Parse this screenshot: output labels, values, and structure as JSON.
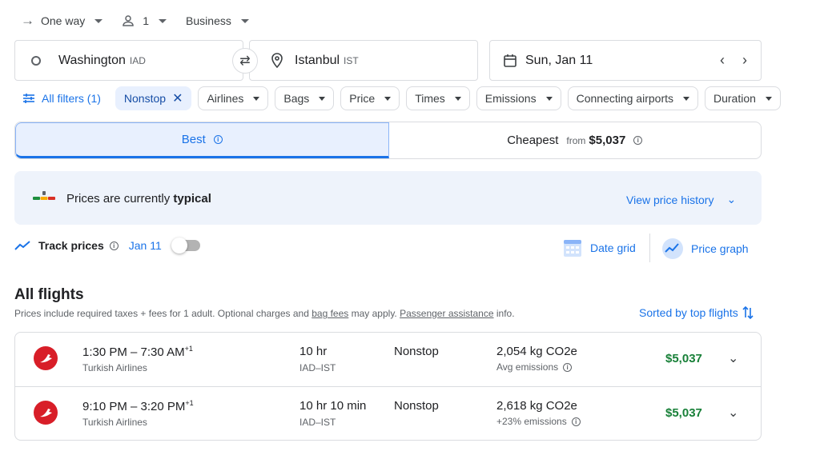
{
  "trip": {
    "type": "One way",
    "passengers": "1",
    "cabin": "Business"
  },
  "search": {
    "from_city": "Washington",
    "from_code": "IAD",
    "to_city": "Istanbul",
    "to_code": "IST",
    "date": "Sun, Jan 11"
  },
  "filters": {
    "all_filters": "All filters (1)",
    "nonstop": "Nonstop",
    "chips": [
      "Airlines",
      "Bags",
      "Price",
      "Times",
      "Emissions",
      "Connecting airports",
      "Duration"
    ]
  },
  "sort_tabs": {
    "best": "Best",
    "cheapest": "Cheapest",
    "from_label": "from",
    "cheapest_price": "$5,037"
  },
  "insight": {
    "prefix": "Prices are currently",
    "level": "typical",
    "view_history": "View price history"
  },
  "track": {
    "label": "Track prices",
    "date": "Jan 11",
    "date_grid": "Date grid",
    "price_graph": "Price graph"
  },
  "results": {
    "heading": "All flights",
    "disclaimer_1": "Prices include required taxes + fees for 1 adult. Optional charges and",
    "bag_fees": "bag fees",
    "disclaimer_2": "may apply.",
    "passenger_assistance": "Passenger assistance",
    "disclaimer_3": "info.",
    "sorted_by": "Sorted by top flights",
    "flights": [
      {
        "times": "1:30 PM – 7:30 AM",
        "day_offset": "+1",
        "airline": "Turkish Airlines",
        "duration": "10 hr",
        "route": "IAD–IST",
        "stops": "Nonstop",
        "emissions": "2,054 kg CO2e",
        "emissions_note": "Avg emissions",
        "price": "$5,037"
      },
      {
        "times": "9:10 PM – 3:20 PM",
        "day_offset": "+1",
        "airline": "Turkish Airlines",
        "duration": "10 hr 10 min",
        "route": "IAD–IST",
        "stops": "Nonstop",
        "emissions": "2,618 kg CO2e",
        "emissions_note": "+23% emissions",
        "price": "$5,037"
      }
    ]
  },
  "colors": {
    "accent": "#1a73e8",
    "price_green": "#188038",
    "turkish_red": "#d81e28"
  }
}
